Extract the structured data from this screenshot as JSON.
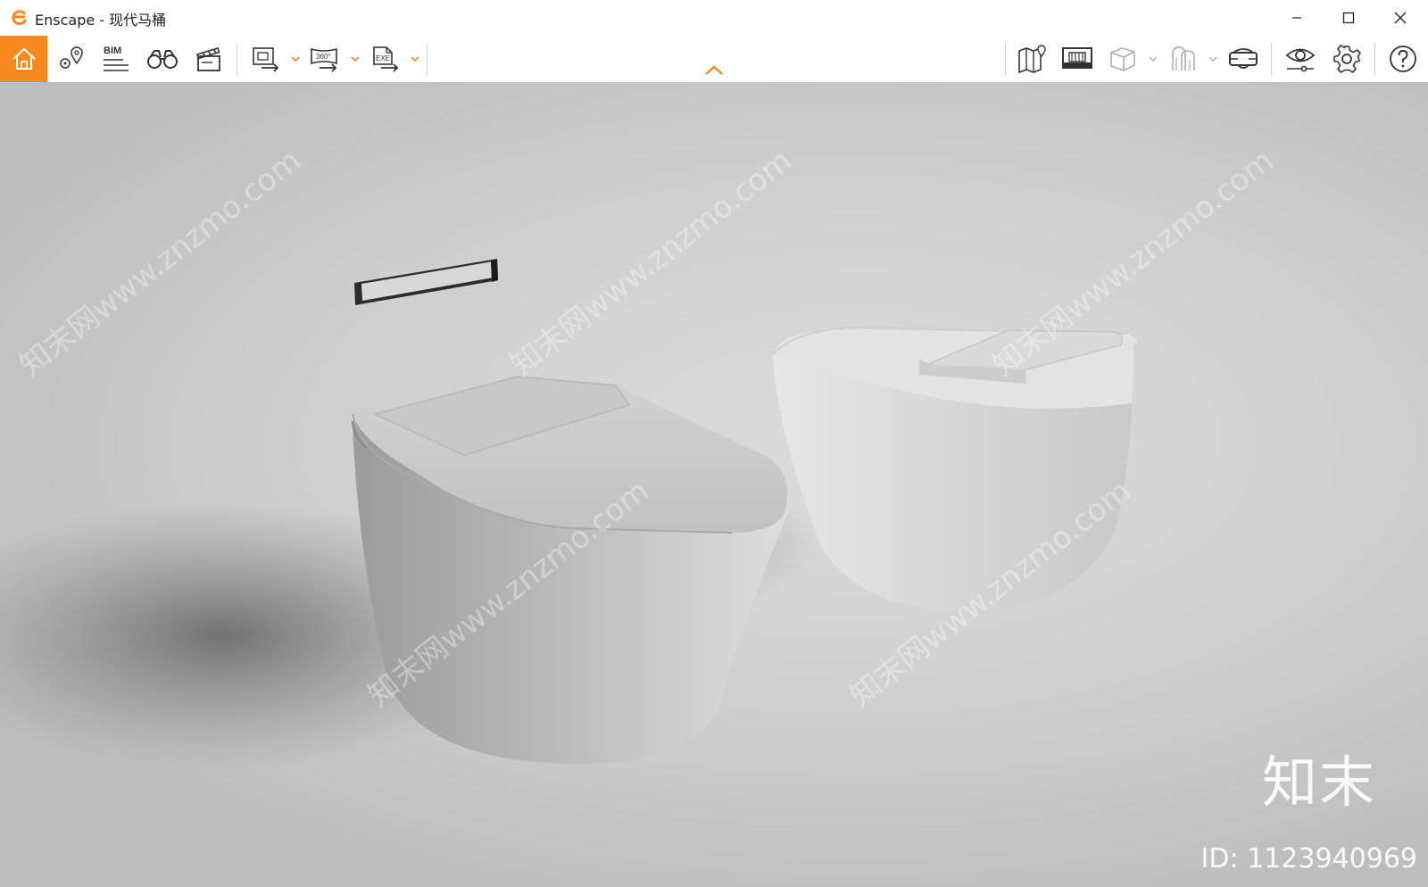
{
  "window": {
    "title": "Enscape - 现代马桶",
    "accent_color": "#f7891e"
  },
  "window_controls": [
    "minimize-icon",
    "maximize-icon",
    "close-icon"
  ],
  "toolbar": {
    "bim_label": "BIM",
    "panorama_label": "360°",
    "exe_label": "EXE",
    "left_icons": [
      "home-icon",
      "location-pin-icon",
      "bim-icon",
      "binoculars-icon",
      "clapperboard-icon",
      "render-export-icon",
      "panorama-export-icon",
      "exe-export-icon"
    ],
    "right_icons": [
      "map-icon",
      "asset-library-icon",
      "cube-view-icon",
      "ghost-mode-icon",
      "vr-headset-icon",
      "visual-settings-icon",
      "settings-icon",
      "help-icon"
    ]
  },
  "watermark": {
    "text": "知末网www.znzmo.com",
    "brand": "知末",
    "id_text": "ID: 1123940969"
  }
}
